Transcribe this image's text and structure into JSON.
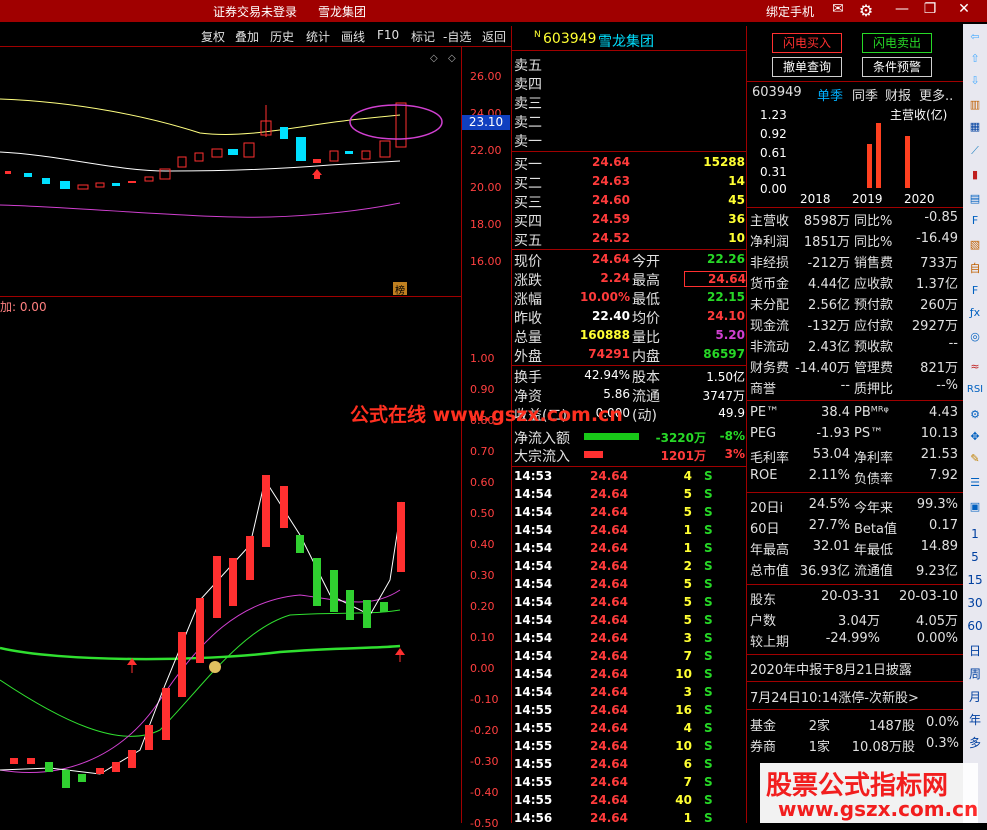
{
  "title_bar": {
    "status": "证券交易未登录",
    "stock_name": "雪龙集团",
    "bind_phone": "绑定手机"
  },
  "toolbar": [
    "复权",
    "叠加",
    "历史",
    "统计",
    "画线",
    "F10",
    "标记",
    "-自选",
    "返回"
  ],
  "main_chart": {
    "price_axis": [
      "26.00",
      "24.00",
      "22.00",
      "20.00",
      "18.00",
      "16.00"
    ],
    "current_price_tag": "23.10",
    "bang_tag": "榜"
  },
  "indicator_chart": {
    "label": "加: 0.00",
    "axis": [
      "1.00",
      "0.90",
      "0.80",
      "0.70",
      "0.60",
      "0.50",
      "0.40",
      "0.30",
      "0.20",
      "0.10",
      "0.00",
      "-0.10",
      "-0.20",
      "-0.30",
      "-0.40",
      "-0.50"
    ]
  },
  "watermark": {
    "center": "公式在线  www.gszx.com.cn",
    "big": "股票公式指标网",
    "small": "www.gszx.com.cn"
  },
  "quote": {
    "code": "603949",
    "name": "雪龙集团",
    "n_mark": "N",
    "sell_levels": [
      "卖五",
      "卖四",
      "卖三",
      "卖二",
      "卖一"
    ],
    "buy_levels": [
      {
        "label": "买一",
        "price": "24.64",
        "vol": "15288"
      },
      {
        "label": "买二",
        "price": "24.63",
        "vol": "14"
      },
      {
        "label": "买三",
        "price": "24.60",
        "vol": "45"
      },
      {
        "label": "买四",
        "price": "24.59",
        "vol": "36"
      },
      {
        "label": "买五",
        "price": "24.52",
        "vol": "10"
      }
    ],
    "stats_left": [
      {
        "label": "现价",
        "value": "24.64"
      },
      {
        "label": "涨跌",
        "value": "2.24"
      },
      {
        "label": "涨幅",
        "value": "10.00%"
      },
      {
        "label": "昨收",
        "value": "22.40"
      },
      {
        "label": "总量",
        "value": "160888"
      },
      {
        "label": "外盘",
        "value": "74291"
      }
    ],
    "stats_right": [
      {
        "label": "今开",
        "value": "22.26"
      },
      {
        "label": "最高",
        "value": "24.64"
      },
      {
        "label": "最低",
        "value": "22.15"
      },
      {
        "label": "均价",
        "value": "24.10"
      },
      {
        "label": "量比",
        "value": "5.20"
      },
      {
        "label": "内盘",
        "value": "86597"
      }
    ],
    "extra": [
      {
        "l1": "换手",
        "v1": "42.94%",
        "l2": "股本",
        "v2": "1.50亿"
      },
      {
        "l1": "净资",
        "v1": "5.86",
        "l2": "流通",
        "v2": "3747万"
      },
      {
        "l1": "收益(二)",
        "v1": "0.000",
        "l2": "(动)",
        "v2": "49.9"
      }
    ],
    "flow": [
      {
        "label": "净流入额",
        "value": "-3220万",
        "pct": "-8%",
        "color": "#18c818",
        "bar": 1.0
      },
      {
        "label": "大宗流入",
        "value": "1201万",
        "pct": "3%",
        "color": "#ff3030",
        "bar": 0.35
      }
    ],
    "ticks": [
      [
        "14:53",
        "24.64",
        "4",
        "S"
      ],
      [
        "14:54",
        "24.64",
        "5",
        "S"
      ],
      [
        "14:54",
        "24.64",
        "5",
        "S"
      ],
      [
        "14:54",
        "24.64",
        "1",
        "S"
      ],
      [
        "14:54",
        "24.64",
        "1",
        "S"
      ],
      [
        "14:54",
        "24.64",
        "2",
        "S"
      ],
      [
        "14:54",
        "24.64",
        "5",
        "S"
      ],
      [
        "14:54",
        "24.64",
        "5",
        "S"
      ],
      [
        "14:54",
        "24.64",
        "5",
        "S"
      ],
      [
        "14:54",
        "24.64",
        "3",
        "S"
      ],
      [
        "14:54",
        "24.64",
        "7",
        "S"
      ],
      [
        "14:54",
        "24.64",
        "10",
        "S"
      ],
      [
        "14:54",
        "24.64",
        "3",
        "S"
      ],
      [
        "14:55",
        "24.64",
        "16",
        "S"
      ],
      [
        "14:55",
        "24.64",
        "4",
        "S"
      ],
      [
        "14:55",
        "24.64",
        "10",
        "S"
      ],
      [
        "14:55",
        "24.64",
        "6",
        "S"
      ],
      [
        "14:55",
        "24.64",
        "7",
        "S"
      ],
      [
        "14:55",
        "24.64",
        "40",
        "S"
      ],
      [
        "14:56",
        "24.64",
        "1",
        "S"
      ]
    ]
  },
  "trade_buttons": {
    "buy": "闪电买入",
    "sell": "闪电卖出",
    "cancel": "撤单查询",
    "alert": "条件预警"
  },
  "fundamentals": {
    "tabs": [
      "603949",
      "单季",
      "同季",
      "财报",
      "更多.."
    ],
    "chart_title": "主营收(亿)",
    "chart_axis": [
      "1.23",
      "0.92",
      "0.61",
      "0.31",
      "0.00"
    ],
    "chart_years": [
      "2018",
      "2019",
      "2020"
    ],
    "rows": [
      {
        "l1": "主营收",
        "v1": "8598万",
        "l2": "同比%",
        "v2": "-0.85"
      },
      {
        "l1": "净利润",
        "v1": "1851万",
        "l2": "同比%",
        "v2": "-16.49"
      },
      {
        "l1": "非经损",
        "v1": "-212万",
        "l2": "销售费",
        "v2": "733万"
      },
      {
        "l1": "货币金",
        "v1": "4.44亿",
        "l2": "应收款",
        "v2": "1.37亿"
      },
      {
        "l1": "未分配",
        "v1": "2.56亿",
        "l2": "预付款",
        "v2": "260万"
      },
      {
        "l1": "现金流",
        "v1": "-132万",
        "l2": "应付款",
        "v2": "2927万"
      },
      {
        "l1": "非流动",
        "v1": "2.43亿",
        "l2": "预收款",
        "v2": "--"
      },
      {
        "l1": "财务费",
        "v1": "-14.40万",
        "l2": "管理费",
        "v2": "821万"
      },
      {
        "l1": "商誉",
        "v1": "--",
        "l2": "质押比",
        "v2": "--%"
      }
    ],
    "ratios": [
      {
        "l1": "PE™",
        "v1": "38.4",
        "l2": "PBᴹᴿᵠ",
        "v2": "4.43"
      },
      {
        "l1": "PEG",
        "v1": "-1.93",
        "l2": "PS™",
        "v2": "10.13"
      },
      {
        "l1": "毛利率",
        "v1": "53.04",
        "l2": "净利率",
        "v2": "21.53"
      },
      {
        "l1": "ROE",
        "v1": "2.11%",
        "l2": "负债率",
        "v2": "7.92"
      }
    ],
    "perf": [
      {
        "l1": "20日i",
        "v1": "24.5%",
        "l2": "今年来",
        "v2": "99.3%"
      },
      {
        "l1": "60日",
        "v1": "27.7%",
        "l2": "Beta值",
        "v2": "0.17"
      },
      {
        "l1": "年最高",
        "v1": "32.01",
        "l2": "年最低",
        "v2": "14.89"
      },
      {
        "l1": "总市值",
        "v1": "36.93亿",
        "l2": "流通值",
        "v2": "9.23亿"
      }
    ],
    "holders": [
      {
        "l1": "股东",
        "v1": "20-03-31",
        "v2": "20-03-10"
      },
      {
        "l1": "户数",
        "v1": "3.04万",
        "v2": "4.05万"
      },
      {
        "l1": "较上期",
        "v1": "-24.99%",
        "v2": "0.00%"
      }
    ],
    "notice1": "2020年中报于8月21日披露",
    "notice2": "7月24日10:14涨停-次新股>",
    "inst": [
      {
        "l1": "基金",
        "v1": "2家",
        "v2": "1487股",
        "v3": "0.0%"
      },
      {
        "l1": "券商",
        "v1": "1家",
        "v2": "10.08万股",
        "v3": "0.3%"
      }
    ]
  },
  "side_periods": [
    "1",
    "5",
    "15",
    "30",
    "60",
    "日",
    "周",
    "月",
    "年",
    "多"
  ]
}
